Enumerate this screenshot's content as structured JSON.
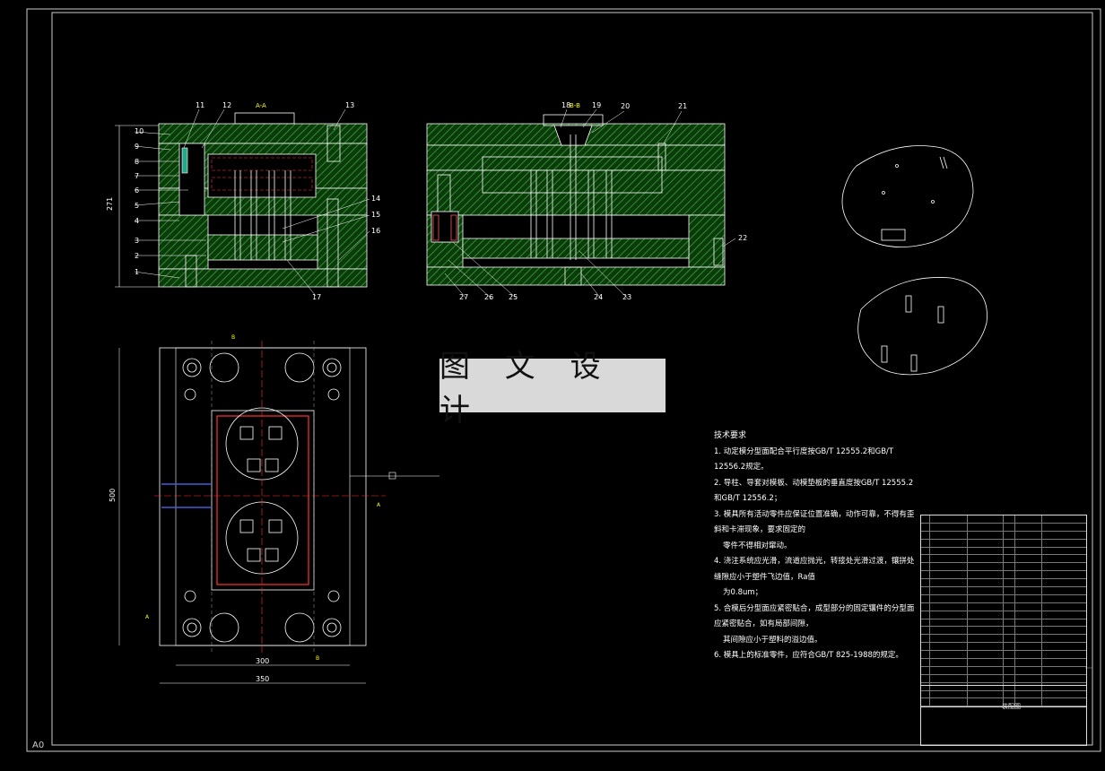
{
  "sheet": {
    "size_label": "A0",
    "watermark": "图 文 设 计",
    "colors": {
      "background": "#000000",
      "hatch": "#1f6b1f",
      "lines": "#ffffff",
      "labels": "#ffffff",
      "annotation": "#ffff00",
      "center": "#ff3333",
      "blue": "#3f5fd0"
    }
  },
  "section_aa": {
    "label": "A-A",
    "dimension": "271",
    "leaders": [
      "10",
      "9",
      "8",
      "7",
      "6",
      "5",
      "4",
      "3",
      "2",
      "1"
    ],
    "top_leaders": [
      "11",
      "12",
      "13"
    ],
    "right_leaders": [
      "14",
      "15",
      "16",
      "17"
    ]
  },
  "section_bb": {
    "label": "B-B",
    "top_leaders": [
      "18",
      "19",
      "20",
      "21"
    ],
    "right_leaders": [
      "22"
    ],
    "bottom_leaders": [
      "27",
      "26",
      "25",
      "24",
      "23"
    ]
  },
  "plan_view": {
    "dim_width_inner": "300",
    "dim_width_outer": "350",
    "dim_height": "500",
    "section_marks": [
      "B",
      "A",
      "A",
      "B"
    ]
  },
  "technical_notes": {
    "title": "技术要求",
    "items": [
      "1. 动定模分型面配合平行度按GB/T 12555.2和GB/T 12556.2规定。",
      "2. 导柱、导套对模板、动模垫板的垂直度按GB/T 12555.2和GB/T 12556.2；",
      "3. 模具所有活动零件应保证位置准确，动作可靠，不得有歪斜和卡滞现象，要求固定的",
      "零件不得相对窜动。",
      "4. 浇注系统应光滑，流道应抛光，转接处光滑过渡，镶拼处缝隙应小于塑件飞边值，Ra值",
      "为0.8um；",
      "5. 合模后分型面应紧密贴合，成型部分的固定镶件的分型面应紧密贴合，如有局部间隙，",
      "其间隙应小于塑料的溢边值。",
      "6. 模具上的标准零件，应符合GB/T 825-1988的规定。"
    ]
  },
  "title_block": {
    "drawing_name": "装配图"
  }
}
